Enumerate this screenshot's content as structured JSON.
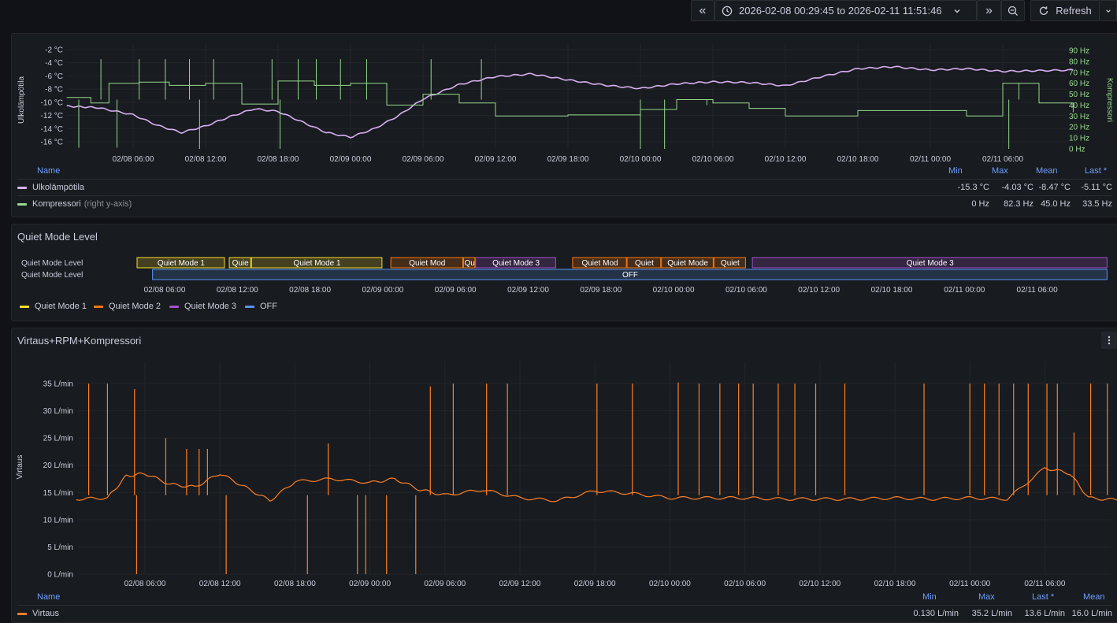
{
  "toolbar": {
    "back_label": "«",
    "time_range": "2026-02-08 00:29:45 to 2026-02-11 11:51:46",
    "forward_label": "»",
    "refresh_label": "Refresh"
  },
  "colors": {
    "bg": "#111217",
    "panel": "#181b1f",
    "grid": "#2a2c33",
    "purple_series": "#d7b0f0",
    "green_series": "#96d98d",
    "orange_series": "#ff7f24",
    "qm1": "#fade2a",
    "qm2": "#ff780a",
    "qm3": "#a352cc",
    "off": "#5794f2",
    "legend_header": "#6e9fff"
  },
  "time_ticks": [
    "02/08 06:00",
    "02/08 12:00",
    "02/08 18:00",
    "02/09 00:00",
    "02/09 06:00",
    "02/09 12:00",
    "02/09 18:00",
    "02/10 00:00",
    "02/10 06:00",
    "02/10 12:00",
    "02/10 18:00",
    "02/11 00:00",
    "02/11 06:00"
  ],
  "panel1": {
    "left_axis_label": "Ulkolämpötila",
    "right_axis_label": "Kompressori",
    "left_ticks": [
      "-2 °C",
      "-4 °C",
      "-6 °C",
      "-8 °C",
      "-10 °C",
      "-12 °C",
      "-14 °C",
      "-16 °C"
    ],
    "right_ticks": [
      "90 Hz",
      "80 Hz",
      "70 Hz",
      "60 Hz",
      "50 Hz",
      "40 Hz",
      "30 Hz",
      "20 Hz",
      "10 Hz",
      "0 Hz"
    ],
    "legend": {
      "name_header": "Name",
      "min_header": "Min",
      "max_header": "Max",
      "mean_header": "Mean",
      "last_header": "Last *",
      "rows": [
        {
          "name": "Ulkolämpötila",
          "suffix": "",
          "color": "#d7b0f0",
          "min": "-15.3 °C",
          "max": "-4.03 °C",
          "mean": "-8.47 °C",
          "last": "-5.11 °C"
        },
        {
          "name": "Kompressori",
          "suffix": "(right y-axis)",
          "color": "#96d98d",
          "min": "0 Hz",
          "max": "82.3 Hz",
          "mean": "45.0 Hz",
          "last": "33.5 Hz"
        }
      ]
    }
  },
  "panel2": {
    "title": "Quiet Mode Level",
    "row_labels": [
      "Quiet Mode Level",
      "Quiet Mode Level"
    ],
    "legend": [
      {
        "label": "Quiet Mode 1",
        "color": "#fade2a"
      },
      {
        "label": "Quiet Mode 2",
        "color": "#ff780a"
      },
      {
        "label": "Quiet Mode 3",
        "color": "#a352cc"
      },
      {
        "label": "OFF",
        "color": "#5794f2"
      }
    ]
  },
  "panel3": {
    "title": "Virtaus+RPM+Kompressori",
    "y_axis_label": "Virtaus",
    "y_ticks": [
      "35 L/min",
      "30 L/min",
      "25 L/min",
      "20 L/min",
      "15 L/min",
      "10 L/min",
      "5 L/min",
      "0 L/min"
    ],
    "legend": {
      "name_header": "Name",
      "min_header": "Min",
      "max_header": "Max",
      "last_header": "Last *",
      "mean_header": "Mean",
      "rows": [
        {
          "name": "Virtaus",
          "color": "#ff7f24",
          "min": "0.130 L/min",
          "max": "35.2 L/min",
          "last": "13.6 L/min",
          "mean": "16.0 L/min"
        }
      ]
    }
  },
  "chart_data": [
    {
      "type": "line",
      "x_range": [
        "2026-02-08 00:29:45",
        "2026-02-11 11:51:46"
      ],
      "series": [
        {
          "name": "Ulkolämpötila",
          "unit": "°C",
          "axis": "left",
          "x": [
            "2026-02-08 00:30",
            "2026-02-08 03:00",
            "2026-02-08 06:00",
            "2026-02-08 08:00",
            "2026-02-08 10:00",
            "2026-02-08 12:00",
            "2026-02-08 14:00",
            "2026-02-08 16:00",
            "2026-02-08 18:00",
            "2026-02-08 20:00",
            "2026-02-08 22:00",
            "2026-02-09 00:00",
            "2026-02-09 02:00",
            "2026-02-09 04:00",
            "2026-02-09 06:00",
            "2026-02-09 09:00",
            "2026-02-09 12:00",
            "2026-02-09 15:00",
            "2026-02-09 18:00",
            "2026-02-09 21:00",
            "2026-02-10 00:00",
            "2026-02-10 03:00",
            "2026-02-10 06:00",
            "2026-02-10 09:00",
            "2026-02-10 12:00",
            "2026-02-10 15:00",
            "2026-02-10 18:00",
            "2026-02-10 21:00",
            "2026-02-11 00:00",
            "2026-02-11 03:00",
            "2026-02-11 06:00",
            "2026-02-11 09:00",
            "2026-02-11 11:50"
          ],
          "y": [
            -10.6,
            -10.8,
            -11.9,
            -13.5,
            -14.6,
            -13.6,
            -12.2,
            -11.0,
            -11.4,
            -13.0,
            -14.6,
            -15.3,
            -14.0,
            -12.0,
            -9.5,
            -7.3,
            -6.1,
            -5.7,
            -6.6,
            -7.4,
            -7.9,
            -7.2,
            -6.9,
            -7.0,
            -7.5,
            -6.1,
            -4.9,
            -4.6,
            -5.1,
            -4.9,
            -5.3,
            -5.2,
            -5.1
          ]
        },
        {
          "name": "Kompressori",
          "unit": "Hz",
          "axis": "right",
          "x": [
            "2026-02-08 00:30",
            "2026-02-08 02:30",
            "2026-02-08 04:00",
            "2026-02-08 06:30",
            "2026-02-08 09:00",
            "2026-02-08 12:00",
            "2026-02-08 15:00",
            "2026-02-08 18:00",
            "2026-02-08 21:00",
            "2026-02-09 00:00",
            "2026-02-09 03:00",
            "2026-02-09 06:00",
            "2026-02-09 09:00",
            "2026-02-09 12:00",
            "2026-02-09 15:00",
            "2026-02-09 18:00",
            "2026-02-10 00:00",
            "2026-02-10 03:00",
            "2026-02-10 06:00",
            "2026-02-10 09:00",
            "2026-02-10 12:00",
            "2026-02-10 15:00",
            "2026-02-10 18:00",
            "2026-02-11 00:00",
            "2026-02-11 03:00",
            "2026-02-11 06:00",
            "2026-02-11 09:00",
            "2026-02-11 11:50"
          ],
          "y": [
            47,
            42,
            60,
            61,
            58,
            60,
            41,
            62,
            58,
            60,
            40,
            50,
            42,
            30,
            30,
            31,
            36,
            45,
            42,
            37,
            30,
            30,
            35,
            35,
            30,
            60,
            42,
            33.5
          ]
        }
      ],
      "left_ylim": [
        -16,
        -2
      ],
      "right_ylim": [
        0,
        90
      ]
    },
    {
      "type": "state-timeline",
      "rows": [
        {
          "segments": [
            {
              "label": "Quiet Mode 1",
              "state": "Quiet Mode 1",
              "start": "2026-02-08 00:30",
              "end": "2026-02-08 11:00"
            },
            {
              "label": "Quie",
              "state": "Quiet Mode 1",
              "start": "2026-02-08 11:20",
              "end": "2026-02-08 13:10"
            },
            {
              "label": "Quiet Mode 1",
              "state": "Quiet Mode 1",
              "start": "2026-02-08 13:10",
              "end": "2026-02-09 00:00"
            },
            {
              "label": "Quiet Mod",
              "state": "Quiet Mode 2",
              "start": "2026-02-09 00:40",
              "end": "2026-02-09 06:40"
            },
            {
              "label": "Qu",
              "state": "Quiet Mode 2",
              "start": "2026-02-09 06:40",
              "end": "2026-02-09 07:40"
            },
            {
              "label": "Quiet Mode 3",
              "state": "Quiet Mode 3",
              "start": "2026-02-09 07:40",
              "end": "2026-02-09 14:20"
            },
            {
              "label": "Quiet Mod",
              "state": "Quiet Mode 2",
              "start": "2026-02-09 15:40",
              "end": "2026-02-09 20:10"
            },
            {
              "label": "Quiet",
              "state": "Quiet Mode 2",
              "start": "2026-02-09 20:10",
              "end": "2026-02-09 23:00"
            },
            {
              "label": "Quiet Mode",
              "state": "Quiet Mode 2",
              "start": "2026-02-09 23:00",
              "end": "2026-02-10 03:20"
            },
            {
              "label": "Quiet",
              "state": "Quiet Mode 2",
              "start": "2026-02-10 03:20",
              "end": "2026-02-10 06:00"
            },
            {
              "label": "Quiet Mode 3",
              "state": "Quiet Mode 3",
              "start": "2026-02-10 06:30",
              "end": "2026-02-11 11:50"
            }
          ]
        },
        {
          "segments": [
            {
              "label": "OFF",
              "state": "OFF",
              "start": "2026-02-08 05:00",
              "end": "2026-02-11 11:50"
            }
          ]
        }
      ]
    },
    {
      "type": "line",
      "x_range": [
        "2026-02-08 00:29:45",
        "2026-02-11 11:51:46"
      ],
      "series": [
        {
          "name": "Virtaus",
          "unit": "L/min",
          "x": [
            "2026-02-08 00:30",
            "2026-02-08 03:00",
            "2026-02-08 04:30",
            "2026-02-08 06:00",
            "2026-02-08 08:00",
            "2026-02-08 10:00",
            "2026-02-08 12:00",
            "2026-02-08 14:00",
            "2026-02-08 16:00",
            "2026-02-08 18:00",
            "2026-02-08 21:00",
            "2026-02-09 00:00",
            "2026-02-09 02:00",
            "2026-02-09 04:00",
            "2026-02-09 06:00",
            "2026-02-09 09:00",
            "2026-02-09 12:00",
            "2026-02-09 15:00",
            "2026-02-09 18:00",
            "2026-02-09 21:00",
            "2026-02-10 00:00",
            "2026-02-10 03:00",
            "2026-02-10 06:00",
            "2026-02-10 09:00",
            "2026-02-10 12:00",
            "2026-02-10 15:00",
            "2026-02-10 18:00",
            "2026-02-10 21:00",
            "2026-02-11 00:00",
            "2026-02-11 03:00",
            "2026-02-11 06:00",
            "2026-02-11 08:00",
            "2026-02-11 09:30",
            "2026-02-11 11:50"
          ],
          "y": [
            13.8,
            14.0,
            18.0,
            18.5,
            16.5,
            16.0,
            18.5,
            16.0,
            13.5,
            17.0,
            17.5,
            16.8,
            17.5,
            15.5,
            14.5,
            15.5,
            14.0,
            13.5,
            15.3,
            14.8,
            14.0,
            14.0,
            14.0,
            13.8,
            13.8,
            13.8,
            14.0,
            13.8,
            14.0,
            13.8,
            19.5,
            18.5,
            14.0,
            13.6
          ]
        }
      ],
      "ylim": [
        0,
        37
      ]
    }
  ]
}
